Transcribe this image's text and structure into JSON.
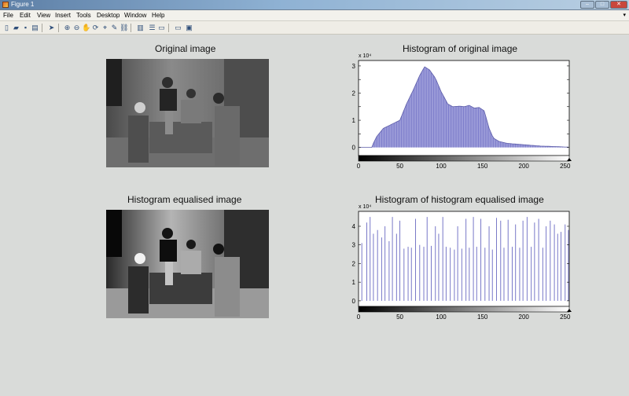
{
  "window": {
    "title": "Figure 1",
    "minimize": "–",
    "maximize": "□",
    "close": "✕"
  },
  "menu": [
    "File",
    "Edit",
    "View",
    "Insert",
    "Tools",
    "Desktop",
    "Window",
    "Help"
  ],
  "menu_overflow": "▾",
  "toolbar": [
    {
      "name": "new-figure-icon",
      "glyph": "▯"
    },
    {
      "name": "open-file-icon",
      "glyph": "▰"
    },
    {
      "name": "save-icon",
      "glyph": "▪"
    },
    {
      "name": "print-icon",
      "glyph": "▤"
    },
    {
      "name": "pointer-icon",
      "glyph": "➤"
    },
    {
      "name": "zoom-in-icon",
      "glyph": "⊕"
    },
    {
      "name": "zoom-out-icon",
      "glyph": "⊖"
    },
    {
      "name": "pan-icon",
      "glyph": "✋"
    },
    {
      "name": "rotate-icon",
      "glyph": "⟳"
    },
    {
      "name": "data-cursor-icon",
      "glyph": "⌖"
    },
    {
      "name": "brush-icon",
      "glyph": "✎"
    },
    {
      "name": "link-icon",
      "glyph": "⛓"
    },
    {
      "name": "colorbar-icon",
      "glyph": "▥"
    },
    {
      "name": "legend-icon",
      "glyph": "☰"
    },
    {
      "name": "hide-tools-icon",
      "glyph": "▭"
    },
    {
      "name": "show-tools-icon",
      "glyph": "▣"
    }
  ],
  "images": {
    "original_title": "Original image",
    "equalised_title": "Histogram equalised image"
  },
  "chart_data": [
    {
      "type": "bar",
      "title": "Histogram of original image",
      "y_multiplier": "x 10⁴",
      "xlim": [
        0,
        255
      ],
      "ylim": [
        -0.3,
        3.2
      ],
      "xticks": [
        0,
        50,
        100,
        150,
        200,
        250
      ],
      "yticks": [
        0,
        0.5,
        1,
        1.5,
        2,
        2.5,
        3
      ],
      "ytick_labels": [
        "0",
        "",
        "1",
        "",
        "2",
        "",
        "3"
      ],
      "bar_color": "#7878c8",
      "profile": [
        [
          0,
          0
        ],
        [
          16,
          0
        ],
        [
          18,
          0.15
        ],
        [
          22,
          0.4
        ],
        [
          30,
          0.7
        ],
        [
          40,
          0.85
        ],
        [
          50,
          1.0
        ],
        [
          58,
          1.6
        ],
        [
          66,
          2.1
        ],
        [
          74,
          2.65
        ],
        [
          80,
          2.97
        ],
        [
          86,
          2.85
        ],
        [
          93,
          2.55
        ],
        [
          100,
          2.05
        ],
        [
          108,
          1.6
        ],
        [
          114,
          1.5
        ],
        [
          122,
          1.52
        ],
        [
          128,
          1.5
        ],
        [
          134,
          1.55
        ],
        [
          140,
          1.45
        ],
        [
          146,
          1.47
        ],
        [
          152,
          1.35
        ],
        [
          158,
          0.7
        ],
        [
          163,
          0.35
        ],
        [
          170,
          0.22
        ],
        [
          180,
          0.15
        ],
        [
          200,
          0.1
        ],
        [
          220,
          0.05
        ],
        [
          240,
          0.03
        ],
        [
          255,
          0.01
        ]
      ]
    },
    {
      "type": "bar",
      "title": "Histogram of histogram equalised image",
      "y_multiplier": "x 10⁴",
      "xlim": [
        0,
        255
      ],
      "ylim": [
        -0.3,
        4.8
      ],
      "xticks": [
        0,
        50,
        100,
        150,
        200,
        250
      ],
      "yticks": [
        0,
        1,
        2,
        3,
        4
      ],
      "bar_color": "#7878c8",
      "bars": [
        [
          4,
          3.1
        ],
        [
          10,
          4.2
        ],
        [
          14,
          4.5
        ],
        [
          18,
          3.6
        ],
        [
          23,
          3.8
        ],
        [
          28,
          3.4
        ],
        [
          32,
          4.0
        ],
        [
          37,
          3.2
        ],
        [
          41,
          4.5
        ],
        [
          46,
          3.6
        ],
        [
          50,
          4.3
        ],
        [
          55,
          2.8
        ],
        [
          60,
          2.9
        ],
        [
          64,
          2.85
        ],
        [
          69,
          4.4
        ],
        [
          74,
          3.0
        ],
        [
          79,
          2.9
        ],
        [
          83,
          4.5
        ],
        [
          88,
          2.95
        ],
        [
          93,
          4.0
        ],
        [
          97,
          3.6
        ],
        [
          102,
          4.5
        ],
        [
          106,
          2.9
        ],
        [
          111,
          2.85
        ],
        [
          116,
          2.75
        ],
        [
          120,
          4.0
        ],
        [
          125,
          2.8
        ],
        [
          130,
          4.4
        ],
        [
          134,
          2.85
        ],
        [
          139,
          4.5
        ],
        [
          143,
          2.9
        ],
        [
          148,
          4.4
        ],
        [
          153,
          2.85
        ],
        [
          158,
          4.0
        ],
        [
          162,
          2.75
        ],
        [
          167,
          4.45
        ],
        [
          172,
          4.3
        ],
        [
          176,
          2.85
        ],
        [
          181,
          4.35
        ],
        [
          186,
          2.9
        ],
        [
          190,
          4.1
        ],
        [
          195,
          2.85
        ],
        [
          199,
          4.3
        ],
        [
          204,
          4.5
        ],
        [
          209,
          2.9
        ],
        [
          213,
          4.2
        ],
        [
          218,
          4.4
        ],
        [
          223,
          2.85
        ],
        [
          227,
          4.0
        ],
        [
          232,
          4.3
        ],
        [
          237,
          4.1
        ],
        [
          241,
          3.6
        ],
        [
          245,
          3.7
        ],
        [
          250,
          4.1
        ],
        [
          254,
          3.8
        ]
      ]
    }
  ]
}
